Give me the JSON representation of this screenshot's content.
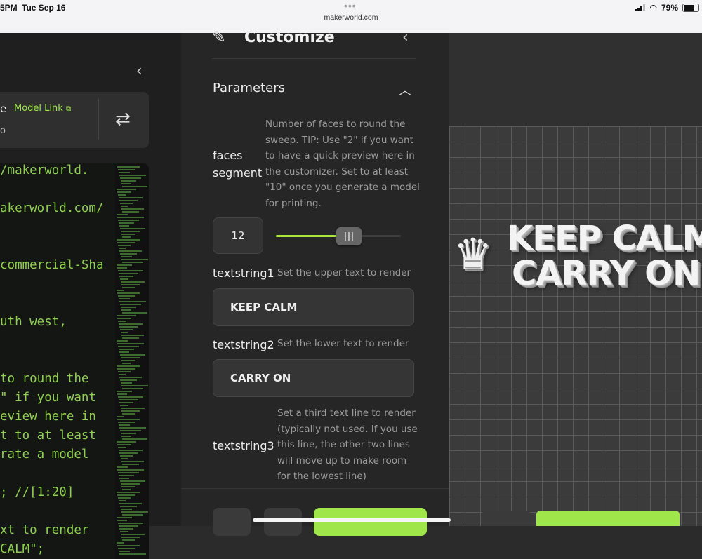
{
  "status_bar": {
    "time": "5PM",
    "date": "Tue Sep 16",
    "url": "makerworld.com",
    "battery": "79%"
  },
  "left_panel": {
    "model_link": "Model Link",
    "code_lines": [
      {
        "text": "/makerworld.",
        "color": "green"
      },
      {
        "text": "akerworld.com/",
        "color": "green"
      },
      {
        "text": "commercial-Sha",
        "color": "green"
      },
      {
        "text": "uth west,",
        "color": "green"
      },
      {
        "text": "to round the",
        "color": "green"
      },
      {
        "text": "\" if you want",
        "color": "green"
      },
      {
        "text": "eview here in",
        "color": "green"
      },
      {
        "text": "t to at least",
        "color": "green"
      },
      {
        "text": "rate a model",
        "color": "green"
      },
      {
        "text": "; //[1:20]",
        "color": "green"
      },
      {
        "text": "xt to render",
        "color": "green"
      },
      {
        "text": "CALM\";",
        "color": "green"
      }
    ]
  },
  "customize": {
    "title": "Customize",
    "section_title": "Parameters",
    "params": {
      "faces_segment": {
        "label": "faces segment",
        "description": "Number of faces to round the sweep. TIP: Use \"2\" if you want to have a quick preview here in the customizer. Set to at least \"10\" once you generate a model for printing.",
        "value": "12",
        "slider_fraction": 0.56
      },
      "textstring1": {
        "label": "textstring1",
        "description": "Set the upper text to render",
        "value": "KEEP CALM"
      },
      "textstring2": {
        "label": "textstring2",
        "description": "Set the lower text to render",
        "value": "CARRY ON"
      },
      "textstring3": {
        "label": "textstring3",
        "description": "Set a third text line to render (typically not used. If you use this line, the other two lines will move up to make room for the lowest line)"
      }
    }
  },
  "viewport": {
    "model_line1": "KEEP CALM",
    "model_line2": "CARRY ON"
  },
  "colors": {
    "accent": "#9fe64b",
    "panel_bg": "#262626"
  }
}
